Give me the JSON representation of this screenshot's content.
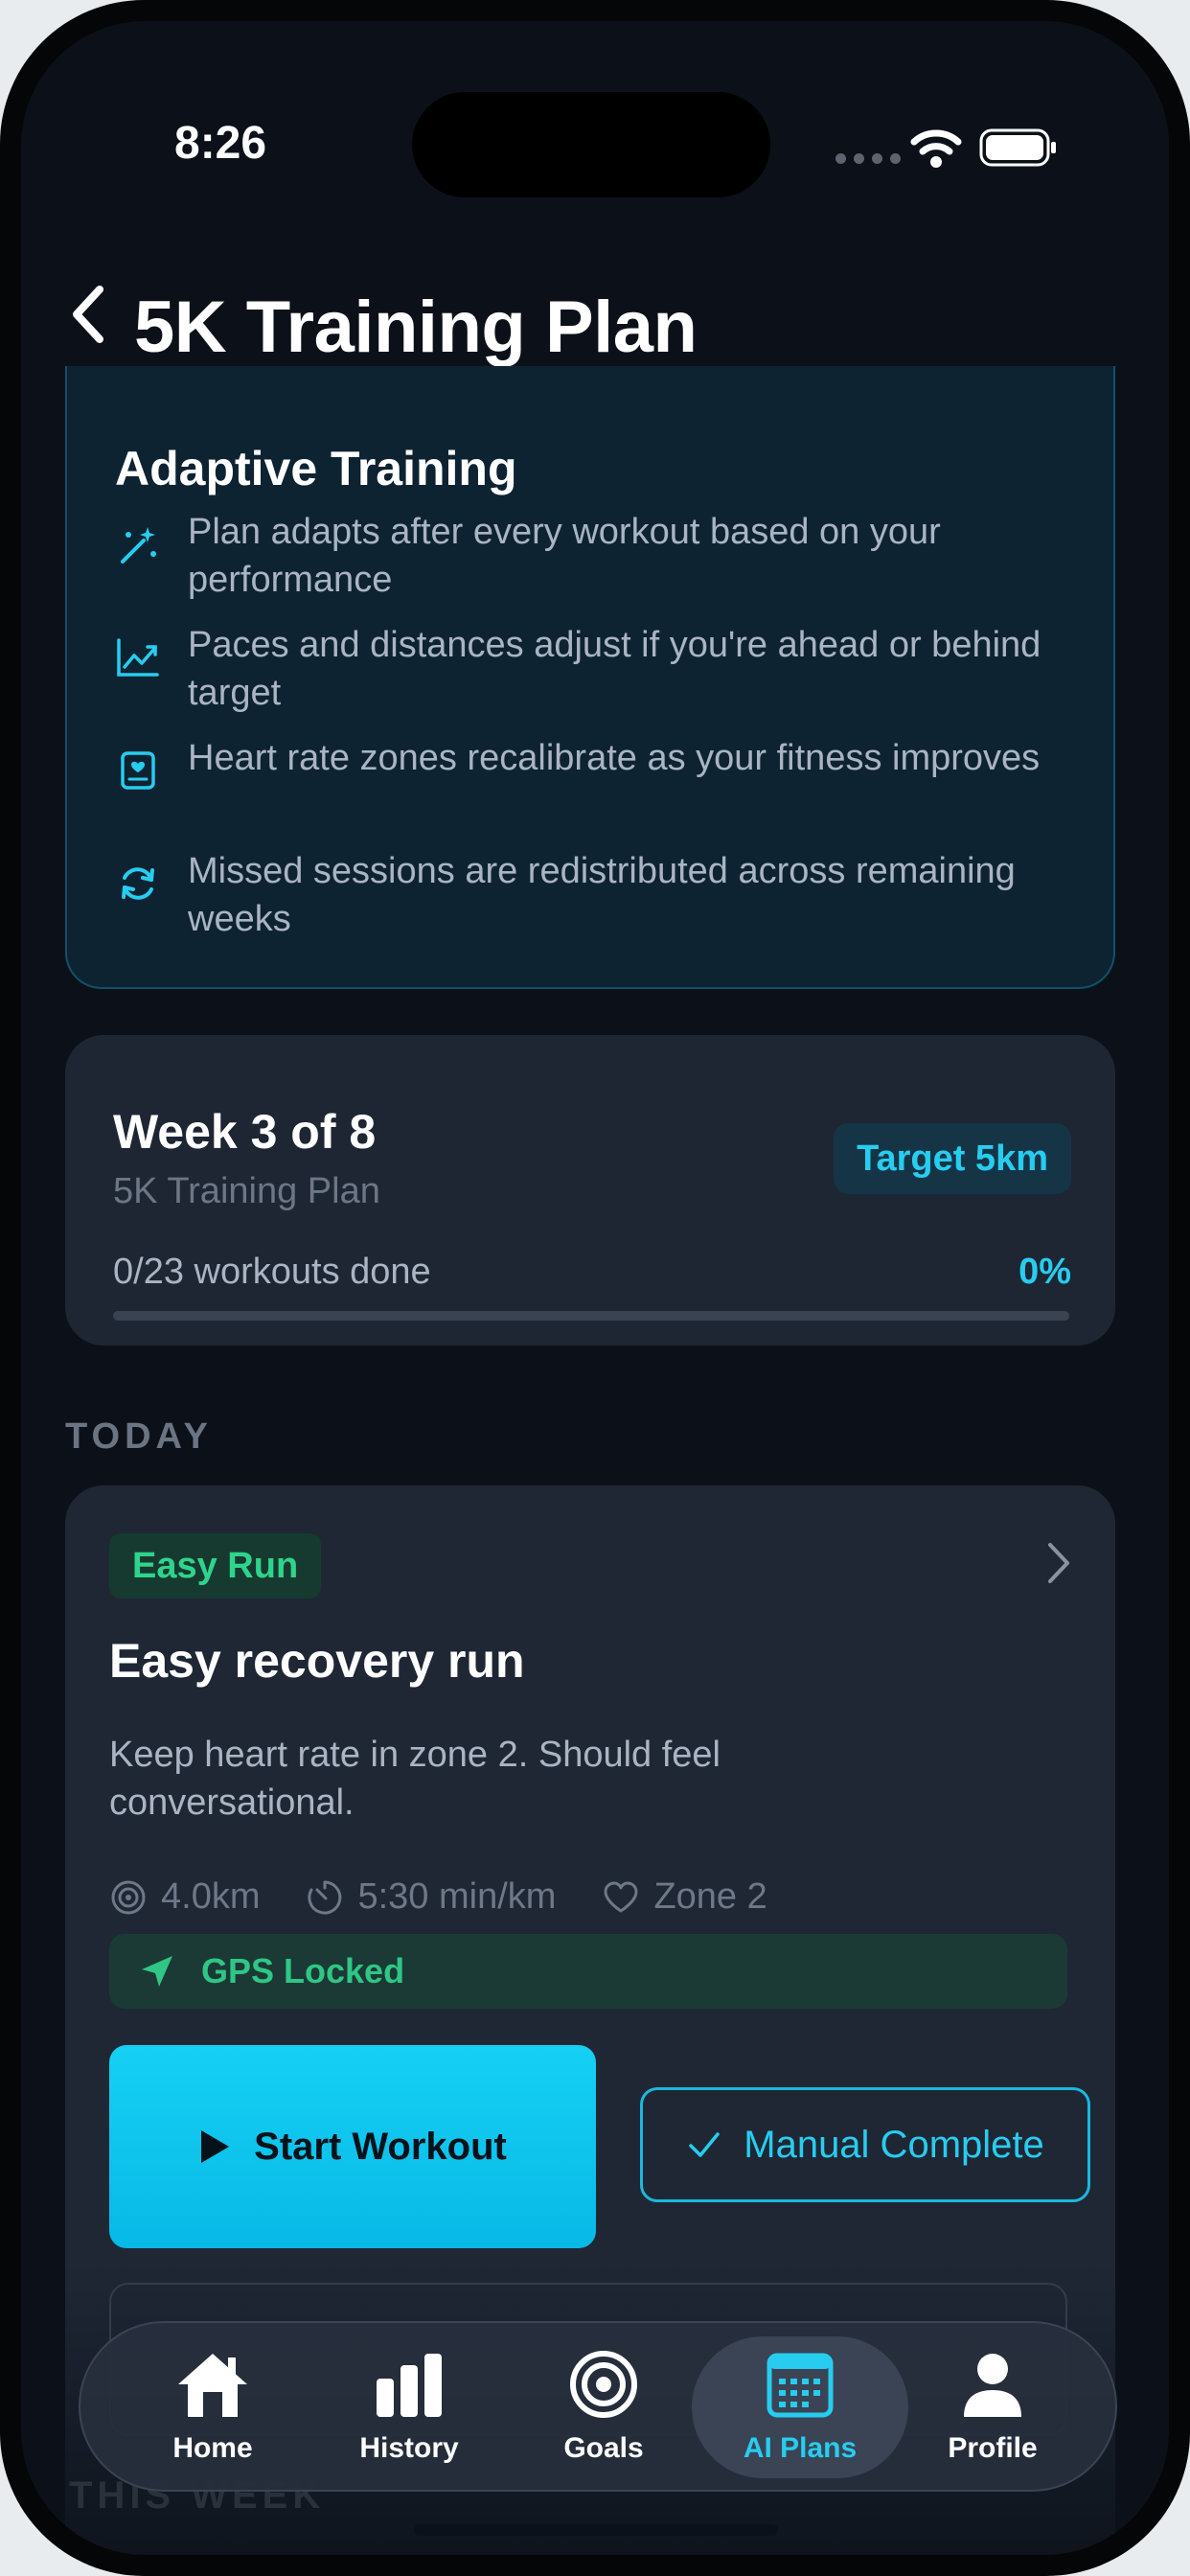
{
  "status_bar": {
    "time": "8:26"
  },
  "header": {
    "title": "5K Training Plan"
  },
  "adaptive": {
    "title": "Adaptive Training",
    "features": [
      {
        "icon": "sparkles-icon",
        "text": "Plan adapts after every workout based on your performance"
      },
      {
        "icon": "trend-chart-icon",
        "text": "Paces and distances adjust if you're ahead or behind target"
      },
      {
        "icon": "heart-monitor-icon",
        "text": "Heart rate zones recalibrate as your fitness improves"
      },
      {
        "icon": "refresh-icon",
        "text": "Missed sessions are redistributed across remaining weeks"
      }
    ]
  },
  "week": {
    "title": "Week 3 of 8",
    "subtitle": "5K Training Plan",
    "target": "Target 5km",
    "progress_text": "0/23 workouts done",
    "progress_percent": "0%",
    "progress_fraction": 0
  },
  "today": {
    "section_label": "TODAY",
    "type": "Easy Run",
    "title": "Easy recovery run",
    "description": "Keep heart rate in zone 2. Should feel conversational.",
    "distance": "4.0km",
    "pace": "5:30 min/km",
    "zone": "Zone 2",
    "gps_status": "GPS Locked",
    "start_label": "Start Workout",
    "manual_label": "Manual Complete"
  },
  "this_week_label": "THIS WEEK",
  "tabs": [
    {
      "label": "Home",
      "icon": "home-icon"
    },
    {
      "label": "History",
      "icon": "bar-chart-icon"
    },
    {
      "label": "Goals",
      "icon": "target-icon"
    },
    {
      "label": "AI Plans",
      "icon": "calendar-icon",
      "active": true
    },
    {
      "label": "Profile",
      "icon": "person-icon"
    }
  ],
  "colors": {
    "accent": "#27cdf0",
    "success": "#2fd48c",
    "background": "#0c1119",
    "card": "#1e2634"
  }
}
